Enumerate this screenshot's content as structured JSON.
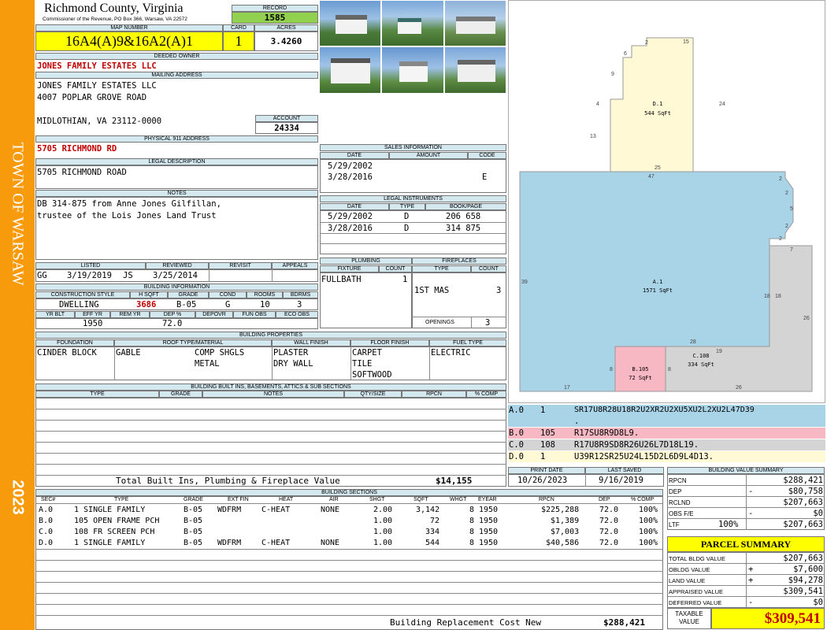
{
  "sidebar": {
    "town": "TOWN OF WARSAW",
    "year": "2023"
  },
  "header": {
    "county": "Richmond County, Virginia",
    "office": "Commissioner of the Revenue, PO Box 366, Warsaw, VA 22572",
    "record_label": "RECORD",
    "record": "1585",
    "map_label": "MAP NUMBER",
    "map_number": "16A4(A)9&16A2(A)1",
    "card_label": "CARD",
    "card": "1",
    "acres_label": "ACRES",
    "acres": "3.4260"
  },
  "owner": {
    "label": "DEEDED OWNER",
    "name": "JONES FAMILY ESTATES LLC",
    "mail_label": "MAILING ADDRESS",
    "mail1": "JONES FAMILY ESTATES LLC",
    "mail2": "4007 POPLAR GROVE ROAD",
    "mail3": "MIDLOTHIAN, VA 23112-0000",
    "account_label": "ACCOUNT",
    "account": "24334"
  },
  "physical": {
    "label": "PHYSICAL 911 ADDRESS",
    "address": "5705 RICHMOND RD"
  },
  "legal": {
    "label": "LEGAL DESCRIPTION",
    "text": "5705 RICHMOND ROAD"
  },
  "notes": {
    "label": "NOTES",
    "line1": "DB 314-875 from Anne Jones Gilfillan,",
    "line2": "trustee of the Lois Jones Land Trust"
  },
  "sales": {
    "label": "SALES INFORMATION",
    "cols": [
      "DATE",
      "AMOUNT",
      "CODE"
    ],
    "rows": [
      {
        "date": "5/29/2002",
        "amount": "",
        "code": ""
      },
      {
        "date": "3/28/2016",
        "amount": "",
        "code": "E"
      }
    ]
  },
  "instruments": {
    "label": "LEGAL INSTRUMENTS",
    "cols": [
      "DATE",
      "TYPE",
      "BOOK/PAGE"
    ],
    "rows": [
      {
        "date": "5/29/2002",
        "type": "D",
        "book": "206 658"
      },
      {
        "date": "3/28/2016",
        "type": "D",
        "book": "314 875"
      }
    ]
  },
  "listed": {
    "listed_label": "LISTED",
    "reviewed_label": "REVIEWED",
    "revisit_label": "REVISIT",
    "appeals_label": "APPEALS",
    "listed_by": "GG",
    "listed_date": "3/19/2019",
    "reviewed_by": "JS",
    "reviewed_date": "3/25/2014"
  },
  "building_info": {
    "label": "BUILDING INFORMATION",
    "cols": [
      "CONSTRUCTION STYLE",
      "H SQFT",
      "GRADE",
      "COND",
      "ROOMS",
      "BDRMS"
    ],
    "style": "DWELLING",
    "hsqft": "3686",
    "grade": "B-05",
    "cond": "G",
    "rooms": "10",
    "bdrms": "3",
    "cols2": [
      "YR BLT",
      "EFF YR",
      "REM YR",
      "DEP %",
      "DEPOVR",
      "FUN OBS",
      "ECO OBS"
    ],
    "eff_yr": "1950",
    "dep": "72.0"
  },
  "plumbing": {
    "label": "PLUMBING",
    "fixture_label": "FIXTURE",
    "count_label": "COUNT",
    "fixture": "FULLBATH",
    "count": "1"
  },
  "fireplaces": {
    "label": "FIREPLACES",
    "type_label": "TYPE",
    "count_label": "COUNT",
    "type": "1ST MAS",
    "count": "3",
    "openings_label": "OPENINGS",
    "openings": "3"
  },
  "properties": {
    "label": "BUILDING PROPERTIES",
    "cols": [
      "FOUNDATION",
      "ROOF TYPE/MATERIAL",
      "WALL FINISH",
      "FLOOR FINISH",
      "FUEL TYPE"
    ],
    "foundation": "CINDER BLOCK",
    "roof_type": "GABLE",
    "roof_mat1": "COMP SHGLS",
    "roof_mat2": "METAL",
    "wall1": "PLASTER",
    "wall2": "DRY WALL",
    "floor1": "CARPET",
    "floor2": "TILE",
    "floor3": "SOFTWOOD",
    "fuel": "ELECTRIC"
  },
  "builtins": {
    "label": "BUILDING BUILT INS, BASEMENTS, ATTICS & SUB SECTIONS",
    "cols": [
      "TYPE",
      "GRADE",
      "NOTES",
      "QTY/SIZE",
      "RPCN",
      "% COMP"
    ],
    "total_label": "Total Built Ins, Plumbing & Fireplace Value",
    "total": "$14,155"
  },
  "sketch": {
    "labels": [
      {
        "t": "D.1",
        "s": "544 SqFt"
      },
      {
        "t": "A.1",
        "s": "1571 SqFt"
      },
      {
        "t": "B.105",
        "s": "72 SqFt"
      },
      {
        "t": "C.108",
        "s": "334 SqFt"
      }
    ],
    "dims": [
      "2",
      "15",
      "6",
      "9",
      "4",
      "24",
      "13",
      "25",
      "47",
      "2",
      "2",
      "5",
      "2",
      "2",
      "7",
      "39",
      "18",
      "18",
      "26",
      "28",
      "19",
      "8",
      "8",
      "17",
      "26"
    ],
    "codes": [
      {
        "a": "A.0",
        "b": "1",
        "c": "SR17U8R28U18R2U2XR2U2XU5XU2L2XU2L47D39"
      },
      {
        "a": ".",
        "b": "",
        "c": ""
      },
      {
        "a": "B.0",
        "b": "105",
        "c": "R17SU8R9D8L9."
      },
      {
        "a": "C.0",
        "b": "108",
        "c": "R17U8R9SD8R26U26L7D18L19."
      },
      {
        "a": "D.0",
        "b": "1",
        "c": "U39R12SR25U24L15D2L6D9L4D13."
      }
    ]
  },
  "print": {
    "print_label": "PRINT DATE",
    "saved_label": "LAST SAVED",
    "print_date": "10/26/2023",
    "saved": "9/16/2019"
  },
  "sections": {
    "label": "BUILDING SECTIONS",
    "cols": [
      "SEC#",
      "TYPE",
      "GRADE",
      "EXT FIN",
      "HEAT",
      "AIR",
      "SHGT",
      "SQFT",
      "WHGT",
      "EYEAR",
      "RPCN",
      "DEP",
      "% COMP"
    ],
    "rows": [
      {
        "sec": "A.0",
        "type": "1 SINGLE FAMILY",
        "grade": "B-05",
        "ext": "WDFRM",
        "heat": "C-HEAT",
        "air": "NONE",
        "shgt": "2.00",
        "sqft": "3,142",
        "whgt": "8",
        "eyear": "1950",
        "rpcn": "$225,288",
        "dep": "72.0",
        "comp": "100%"
      },
      {
        "sec": "B.0",
        "type": "105 OPEN FRAME PCH",
        "grade": "B-05",
        "ext": "",
        "heat": "",
        "air": "",
        "shgt": "1.00",
        "sqft": "72",
        "whgt": "8",
        "eyear": "1950",
        "rpcn": "$1,389",
        "dep": "72.0",
        "comp": "100%"
      },
      {
        "sec": "C.0",
        "type": "108 FR SCREEN PCH",
        "grade": "B-05",
        "ext": "",
        "heat": "",
        "air": "",
        "shgt": "1.00",
        "sqft": "334",
        "whgt": "8",
        "eyear": "1950",
        "rpcn": "$7,003",
        "dep": "72.0",
        "comp": "100%"
      },
      {
        "sec": "D.0",
        "type": "1 SINGLE FAMILY",
        "grade": "B-05",
        "ext": "WDFRM",
        "heat": "C-HEAT",
        "air": "NONE",
        "shgt": "1.00",
        "sqft": "544",
        "whgt": "8",
        "eyear": "1950",
        "rpcn": "$40,586",
        "dep": "72.0",
        "comp": "100%"
      }
    ],
    "total_label": "Building Replacement Cost New",
    "total": "$288,421"
  },
  "value_summary": {
    "label": "BUILDING VALUE SUMMARY",
    "rows": [
      {
        "k": "RPCN",
        "s": "",
        "v": "$288,421"
      },
      {
        "k": "DEP",
        "s": "-",
        "v": "$80,758"
      },
      {
        "k": "RCLND",
        "s": "",
        "v": "$207,663"
      },
      {
        "k": "OBS F/E",
        "s": "-",
        "v": "$0"
      },
      {
        "k": "LTF",
        "s": "100%",
        "v": "$207,663"
      }
    ]
  },
  "parcel": {
    "label": "PARCEL SUMMARY",
    "rows": [
      {
        "k": "TOTAL BLDG VALUE",
        "s": "",
        "v": "$207,663"
      },
      {
        "k": "OBLDG VALUE",
        "s": "+",
        "v": "$7,600"
      },
      {
        "k": "LAND VALUE",
        "s": "+",
        "v": "$94,278"
      },
      {
        "k": "APPRAISED VALUE",
        "s": "",
        "v": "$309,541"
      },
      {
        "k": "DEFERRED VALUE",
        "s": "-",
        "v": "$0"
      }
    ],
    "taxable_label1": "TAXABLE",
    "taxable_label2": "VALUE",
    "taxable": "$309,541"
  },
  "colors": {
    "sidebar": "#f79a0c",
    "yellow": "#ffff00",
    "green": "#92d050",
    "header_blue": "#d4e8f0",
    "sketch_blue": "#a9d4e8",
    "sketch_yellow": "#fff9d6",
    "sketch_pink": "#f7b8c4",
    "sketch_gray": "#d4d4d4",
    "red_text": "#c00000"
  }
}
